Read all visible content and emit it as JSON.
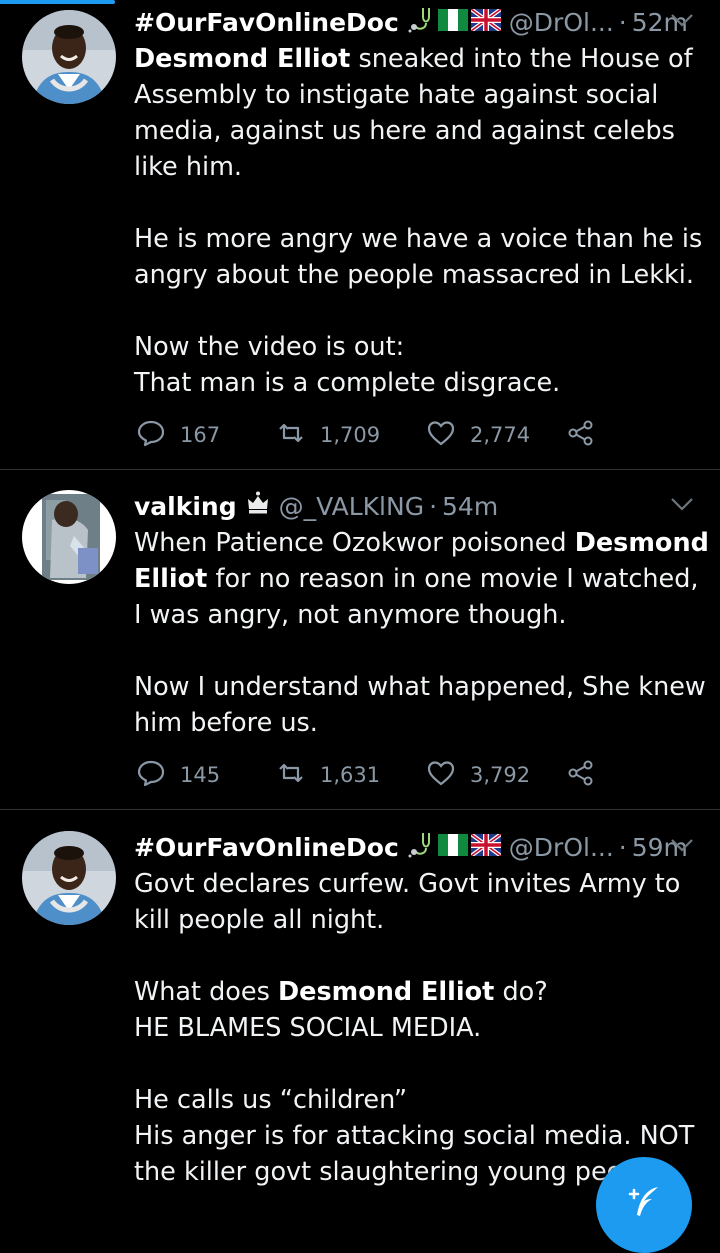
{
  "tweets": [
    {
      "display_name": "#OurFavOnlineDoc",
      "badges": [
        "stethoscope-icon",
        "nigeria-flag-icon",
        "uk-flag-icon"
      ],
      "handle": "@DrOl...",
      "separator": "·",
      "time": "52m",
      "body": [
        [
          {
            "t": "Desmond Elliot",
            "b": true
          },
          {
            "t": " sneaked into the House of Assembly to instigate hate against social media, against us here and against celebs like him."
          }
        ],
        [
          {
            "t": "He is more angry we have a voice than he is angry about the people massacred in Lekki."
          }
        ],
        [
          {
            "t": "Now the video is out:\nThat man is a complete disgrace."
          }
        ]
      ],
      "replies": "167",
      "retweets": "1,709",
      "likes": "2,774"
    },
    {
      "display_name": "valking",
      "badges": [
        "crown-icon"
      ],
      "handle": "@_VALKlNG",
      "separator": "·",
      "time": "54m",
      "body": [
        [
          {
            "t": "When Patience Ozokwor poisoned "
          },
          {
            "t": "Desmond Elliot",
            "b": true
          },
          {
            "t": " for no reason in one movie I watched, I was angry, not anymore though."
          }
        ],
        [
          {
            "t": "Now I understand what happened, She knew him before us."
          }
        ]
      ],
      "replies": "145",
      "retweets": "1,631",
      "likes": "3,792"
    },
    {
      "display_name": "#OurFavOnlineDoc",
      "badges": [
        "stethoscope-icon",
        "nigeria-flag-icon",
        "uk-flag-icon"
      ],
      "handle": "@DrOl...",
      "separator": "·",
      "time": "59m",
      "body": [
        [
          {
            "t": "Govt declares curfew. Govt invites Army to kill people all night."
          }
        ],
        [
          {
            "t": "What does "
          },
          {
            "t": "Desmond Elliot",
            "b": true
          },
          {
            "t": " do?\nHE BLAMES SOCIAL MEDIA."
          }
        ],
        [
          {
            "t": "He calls us “children”\nHis anger is for attacking social media. NOT the killer govt slaughtering young peo"
          }
        ]
      ]
    }
  ],
  "compose_button": {
    "icon": "compose-tweet-icon"
  },
  "colors": {
    "accent": "#1d9bf0",
    "muted": "#8b98a5",
    "divider": "#2f3336",
    "background": "#000000"
  }
}
